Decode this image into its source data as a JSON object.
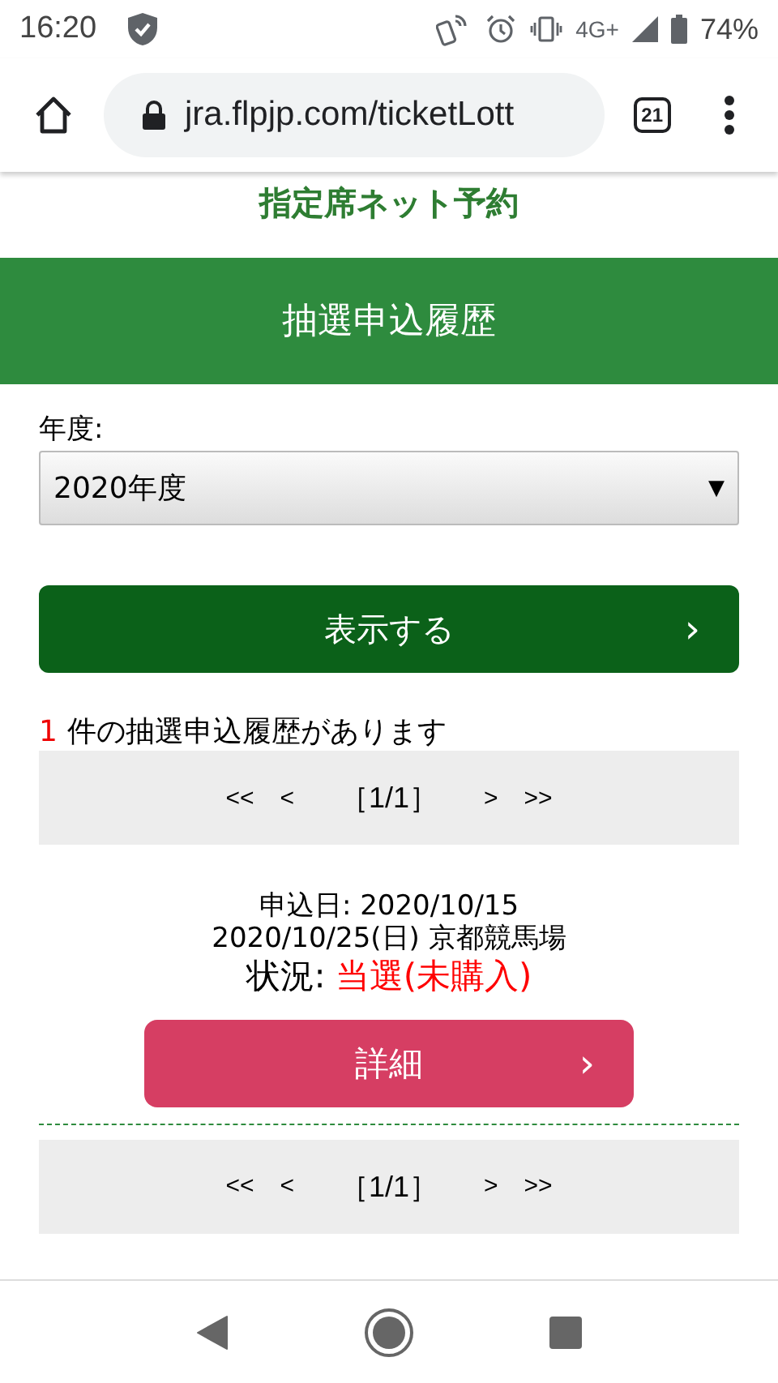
{
  "status_bar": {
    "time": "16:20",
    "network": "4G+",
    "battery": "74%"
  },
  "browser": {
    "url": "jra.flpjp.com/ticketLott",
    "tab_count": "21"
  },
  "site_title": "指定席ネット予約",
  "page_header": "抽選申込履歴",
  "year_filter": {
    "label": "年度:",
    "value": "2020年度",
    "arrow": "▼"
  },
  "show_button": {
    "label": "表示する",
    "chevron": "›"
  },
  "result_count": {
    "count": "1",
    "text": "件の抽選申込履歴があります"
  },
  "pagers": [
    {
      "first": "<<",
      "prev": "<",
      "page": "［1/1］",
      "next": ">",
      "last": ">>"
    },
    {
      "first": "<<",
      "prev": "<",
      "page": "［1/1］",
      "next": ">",
      "last": ">>"
    }
  ],
  "entries": [
    {
      "applied": "申込日: 2020/10/15",
      "race": "2020/10/25(日) 京都競馬場",
      "status_label": "状況:",
      "status": "当選(未購入)",
      "won": true,
      "button": "詳細",
      "chevron": "›"
    }
  ]
}
